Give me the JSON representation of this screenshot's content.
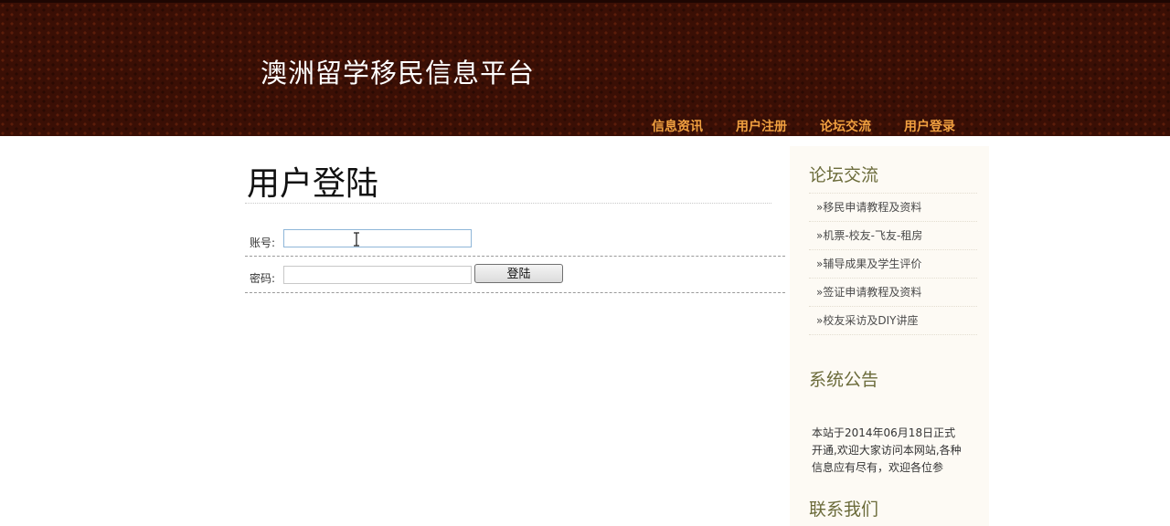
{
  "header": {
    "site_title": "澳洲留学移民信息平台",
    "nav": [
      {
        "label": "信息资讯"
      },
      {
        "label": "用户注册"
      },
      {
        "label": "论坛交流"
      },
      {
        "label": "用户登录"
      }
    ]
  },
  "main": {
    "heading": "用户登陆",
    "account_label": "账号:",
    "account_value": "",
    "password_label": "密码:",
    "password_value": "",
    "login_button": "登陆"
  },
  "sidebar": {
    "forum_heading": "论坛交流",
    "forum_links": [
      {
        "label": "»移民申请教程及资料"
      },
      {
        "label": "»机票-校友-飞友-租房"
      },
      {
        "label": "»辅导成果及学生评价"
      },
      {
        "label": "»签证申请教程及资料"
      },
      {
        "label": "»校友采访及DIY讲座"
      }
    ],
    "notice_heading": "系统公告",
    "notice_text": "本站于2014年06月18日正式开通,欢迎大家访问本网站,各种信息应有尽有，欢迎各位参",
    "contact_heading": "联系我们"
  },
  "colors": {
    "header_bg": "#3a0f05",
    "nav_link": "#f0a040",
    "sidebar_heading": "#6b6b3a",
    "sidebar_bg": "#fdfaf4"
  },
  "icons": {
    "cursor": "text-cursor-icon"
  }
}
